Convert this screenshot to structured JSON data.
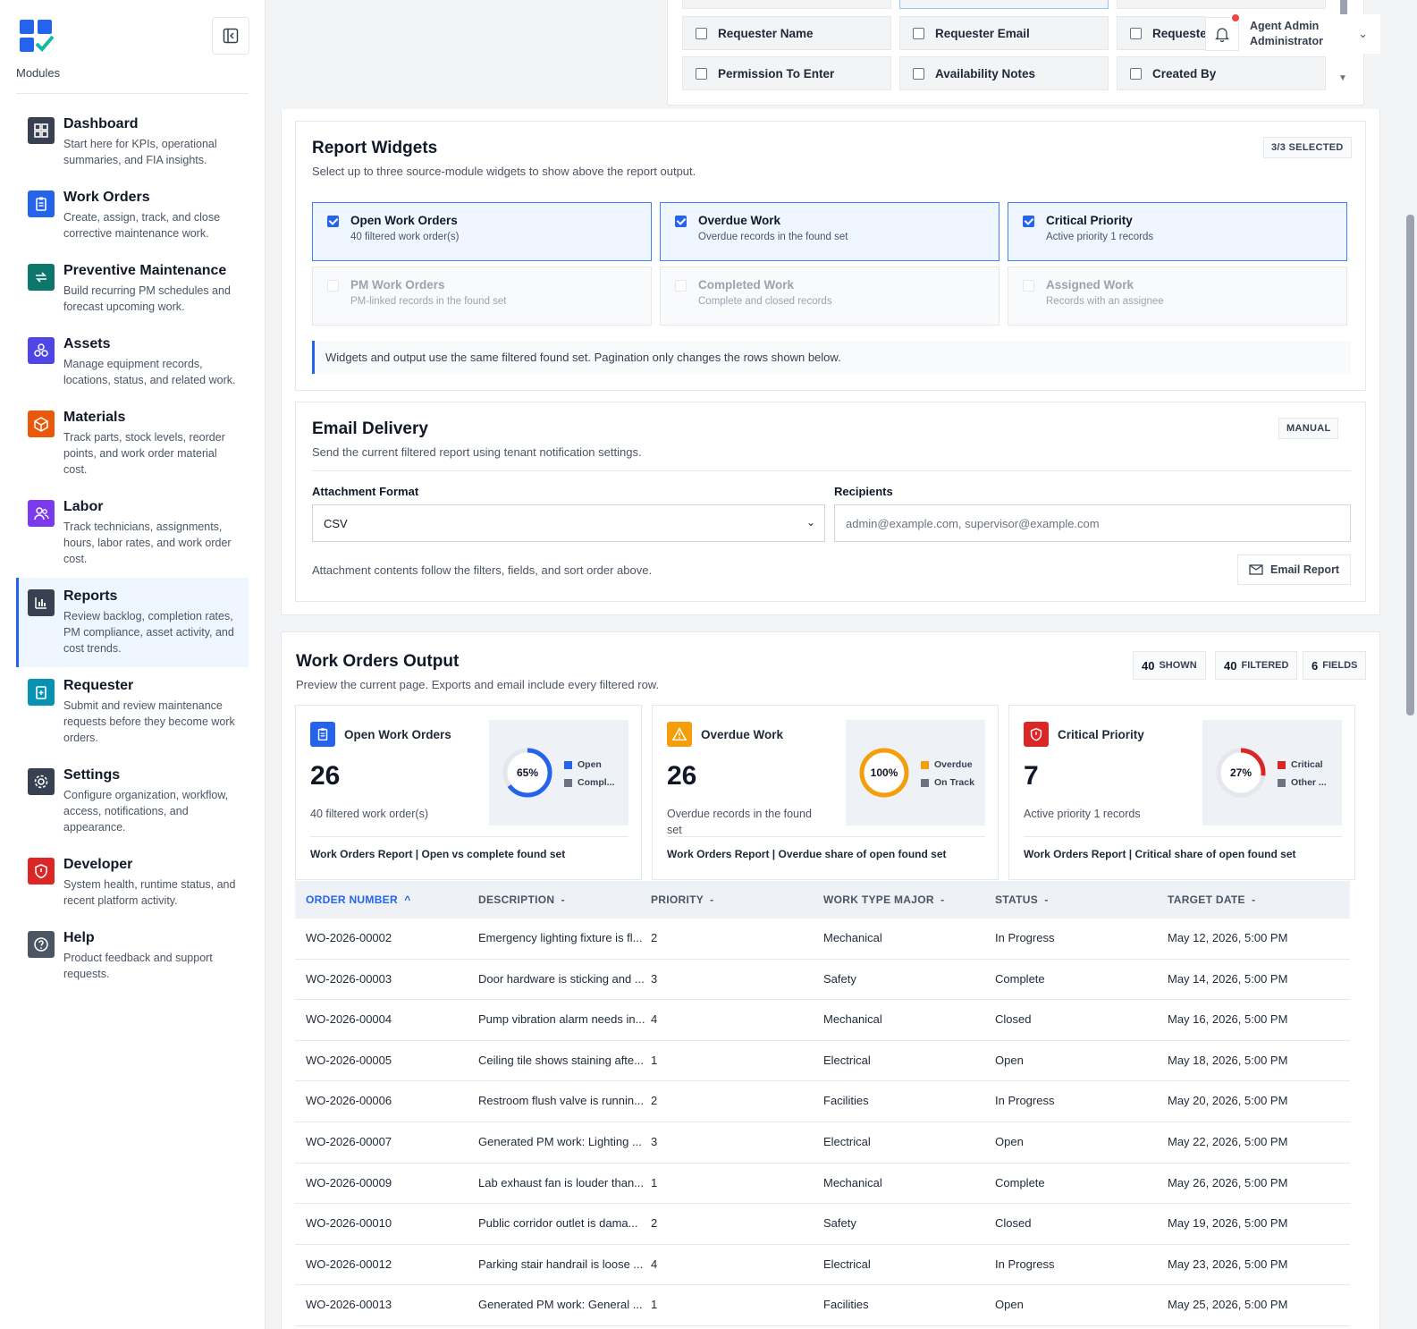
{
  "sidebar": {
    "modules_label": "Modules",
    "items": [
      {
        "title": "Dashboard",
        "desc": "Start here for KPIs, operational summaries, and FIA insights.",
        "icon": "dashboard-icon",
        "color": "#374151"
      },
      {
        "title": "Work Orders",
        "desc": "Create, assign, track, and close corrective maintenance work.",
        "icon": "clipboard-icon",
        "color": "#2563eb"
      },
      {
        "title": "Preventive Maintenance",
        "desc": "Build recurring PM schedules and forecast upcoming work.",
        "icon": "repeat-icon",
        "color": "#0f766e"
      },
      {
        "title": "Assets",
        "desc": "Manage equipment records, locations, status, and related work.",
        "icon": "assets-icon",
        "color": "#4f46e5"
      },
      {
        "title": "Materials",
        "desc": "Track parts, stock levels, reorder points, and work order material cost.",
        "icon": "box-icon",
        "color": "#ea580c"
      },
      {
        "title": "Labor",
        "desc": "Track technicians, assignments, hours, labor rates, and work order cost.",
        "icon": "people-icon",
        "color": "#7c3aed"
      },
      {
        "title": "Reports",
        "desc": "Review backlog, completion rates, PM compliance, asset activity, and cost trends.",
        "icon": "bar-chart-icon",
        "color": "#374151"
      },
      {
        "title": "Requester",
        "desc": "Submit and review maintenance requests before they become work orders.",
        "icon": "request-icon",
        "color": "#0891b2"
      },
      {
        "title": "Settings",
        "desc": "Configure organization, workflow, access, notifications, and appearance.",
        "icon": "gear-icon",
        "color": "#374151"
      },
      {
        "title": "Developer",
        "desc": "System health, runtime status, and recent platform activity.",
        "icon": "shield-icon",
        "color": "#dc2626"
      },
      {
        "title": "Help",
        "desc": "Product feedback and support requests.",
        "icon": "help-icon",
        "color": "#4b5563"
      }
    ]
  },
  "user": {
    "name": "Agent Admin",
    "role": "Administrator"
  },
  "fields": {
    "row1": [
      "Requester Name",
      "Requester Email",
      "Requeste"
    ],
    "row2": [
      "Permission To Enter",
      "Availability Notes",
      "Created By"
    ]
  },
  "widgets": {
    "title": "Report Widgets",
    "subtitle": "Select up to three source-module widgets to show above the report output.",
    "selected_badge": "3/3 SELECTED",
    "options": [
      {
        "title": "Open Work Orders",
        "sub": "40 filtered work order(s)",
        "selected": true
      },
      {
        "title": "Overdue Work",
        "sub": "Overdue records in the found set",
        "selected": true
      },
      {
        "title": "Critical Priority",
        "sub": "Active priority 1 records",
        "selected": true
      },
      {
        "title": "PM Work Orders",
        "sub": "PM-linked records in the found set",
        "selected": false
      },
      {
        "title": "Completed Work",
        "sub": "Complete and closed records",
        "selected": false
      },
      {
        "title": "Assigned Work",
        "sub": "Records with an assignee",
        "selected": false
      }
    ],
    "note": "Widgets and output use the same filtered found set. Pagination only changes the rows shown below."
  },
  "email": {
    "title": "Email Delivery",
    "subtitle": "Send the current filtered report using tenant notification settings.",
    "badge": "MANUAL",
    "format_label": "Attachment Format",
    "format_value": "CSV",
    "recipients_label": "Recipients",
    "recipients_placeholder": "admin@example.com, supervisor@example.com",
    "footnote": "Attachment contents follow the filters, fields, and sort order above.",
    "button": "Email Report"
  },
  "output": {
    "title": "Work Orders Output",
    "subtitle": "Preview the current page. Exports and email include every filtered row.",
    "stats": [
      {
        "n": "40",
        "t": "SHOWN"
      },
      {
        "n": "40",
        "t": "FILTERED"
      },
      {
        "n": "6",
        "t": "FIELDS"
      }
    ],
    "cards": [
      {
        "title": "Open Work Orders",
        "num": "26",
        "sub": "40 filtered work order(s)",
        "pct": 0.65,
        "pct_label": "65%",
        "color": "#2563eb",
        "legend": [
          "Open",
          "Compl..."
        ],
        "legend_colors": [
          "#2563eb",
          "#6b7280"
        ],
        "foot": "Work Orders Report | Open vs complete found set",
        "icon_bg": "#2563eb"
      },
      {
        "title": "Overdue Work",
        "num": "26",
        "sub": "Overdue records in the found set",
        "pct": 1.0,
        "pct_label": "100%",
        "color": "#f59e0b",
        "legend": [
          "Overdue",
          "On Track"
        ],
        "legend_colors": [
          "#f59e0b",
          "#6b7280"
        ],
        "foot": "Work Orders Report | Overdue share of open found set",
        "icon_bg": "#f59e0b"
      },
      {
        "title": "Critical Priority",
        "num": "7",
        "sub": "Active priority 1 records",
        "pct": 0.27,
        "pct_label": "27%",
        "color": "#dc2626",
        "legend": [
          "Critical",
          "Other ..."
        ],
        "legend_colors": [
          "#dc2626",
          "#6b7280"
        ],
        "foot": "Work Orders Report | Critical share of open found set",
        "icon_bg": "#dc2626"
      }
    ],
    "columns": [
      "ORDER NUMBER",
      "DESCRIPTION",
      "PRIORITY",
      "WORK TYPE MAJOR",
      "STATUS",
      "TARGET DATE"
    ],
    "sort_up": "^",
    "sort_down": "-",
    "rows": [
      [
        "WO-2026-00002",
        "Emergency lighting fixture is fl...",
        "2",
        "Mechanical",
        "In Progress",
        "May 12, 2026, 5:00 PM"
      ],
      [
        "WO-2026-00003",
        "Door hardware is sticking and ...",
        "3",
        "Safety",
        "Complete",
        "May 14, 2026, 5:00 PM"
      ],
      [
        "WO-2026-00004",
        "Pump vibration alarm needs in...",
        "4",
        "Mechanical",
        "Closed",
        "May 16, 2026, 5:00 PM"
      ],
      [
        "WO-2026-00005",
        "Ceiling tile shows staining afte...",
        "1",
        "Electrical",
        "Open",
        "May 18, 2026, 5:00 PM"
      ],
      [
        "WO-2026-00006",
        "Restroom flush valve is runnin...",
        "2",
        "Facilities",
        "In Progress",
        "May 20, 2026, 5:00 PM"
      ],
      [
        "WO-2026-00007",
        "Generated PM work: Lighting ...",
        "3",
        "Electrical",
        "Open",
        "May 22, 2026, 5:00 PM"
      ],
      [
        "WO-2026-00009",
        "Lab exhaust fan is louder than...",
        "1",
        "Mechanical",
        "Complete",
        "May 26, 2026, 5:00 PM"
      ],
      [
        "WO-2026-00010",
        "Public corridor outlet is dama...",
        "2",
        "Safety",
        "Closed",
        "May 19, 2026, 5:00 PM"
      ],
      [
        "WO-2026-00012",
        "Parking stair handrail is loose ...",
        "4",
        "Electrical",
        "In Progress",
        "May 23, 2026, 5:00 PM"
      ],
      [
        "WO-2026-00013",
        "Generated PM work: General ...",
        "1",
        "Facilities",
        "Open",
        "May 25, 2026, 5:00 PM"
      ]
    ]
  }
}
